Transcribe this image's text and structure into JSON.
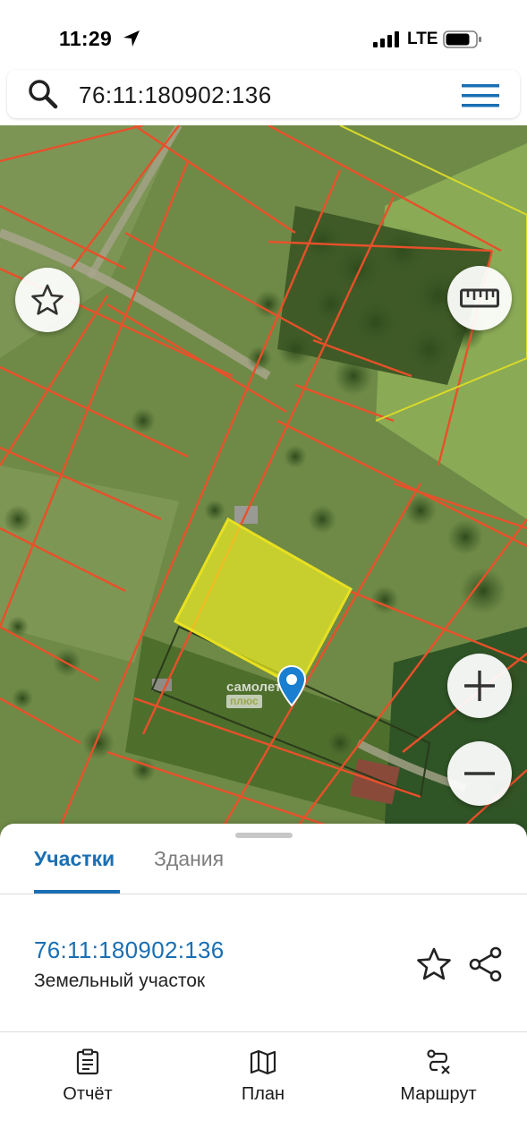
{
  "status_bar": {
    "time": "11:29",
    "network": "LTE",
    "icons": [
      "location-arrow-icon",
      "signal-icon",
      "battery-icon"
    ]
  },
  "search": {
    "query": "76:11:180902:136",
    "icons": [
      "search-icon",
      "menu-icon"
    ]
  },
  "map": {
    "watermark": "самолет",
    "watermark_sub": "плюс",
    "selected_parcel_fill": "#f0f020",
    "boundary_color": "#e8502a",
    "controls": [
      "favorite-icon",
      "ruler-icon",
      "zoom-in-icon",
      "zoom-out-icon",
      "layers-icon",
      "locate-icon"
    ]
  },
  "sheet": {
    "tabs": [
      {
        "label": "Участки",
        "active": true
      },
      {
        "label": "Здания",
        "active": false
      }
    ],
    "result": {
      "number": "76:11:180902:136",
      "type": "Земельный участок"
    },
    "accent": "#1a6fb3"
  },
  "bottom_nav": {
    "items": [
      {
        "label": "Отчёт",
        "icon": "report-icon"
      },
      {
        "label": "План",
        "icon": "map-plan-icon"
      },
      {
        "label": "Маршрут",
        "icon": "route-icon"
      }
    ]
  }
}
